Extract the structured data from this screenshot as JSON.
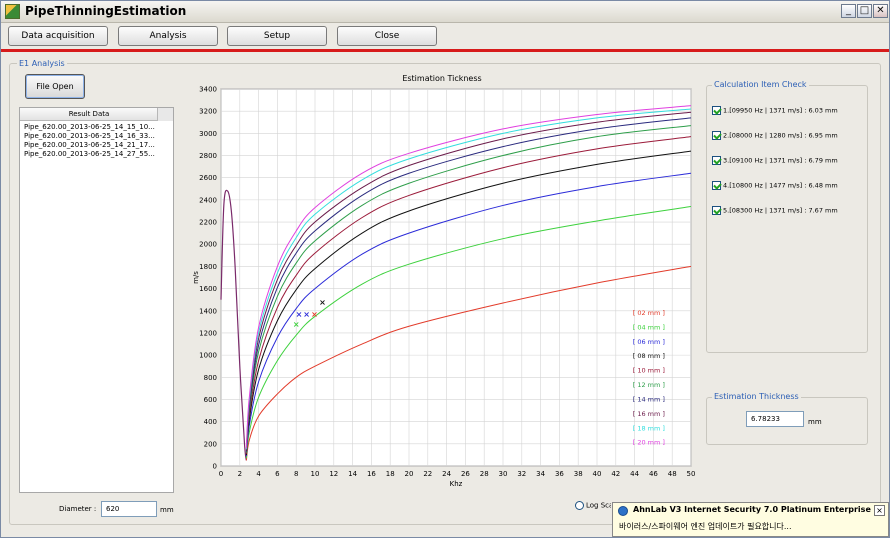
{
  "window": {
    "title": "PipeThinningEstimation",
    "controls": {
      "minimize": "_",
      "maximize": "□",
      "close": "✕"
    }
  },
  "toolbar": {
    "data_acquisition": "Data acquisition",
    "analysis": "Analysis",
    "setup": "Setup",
    "close": "Close"
  },
  "colors": {
    "accent_line": "#d71b1b",
    "group_label": "#2c5fb5"
  },
  "main_group": {
    "label": "E1 Analysis"
  },
  "file_open": "File Open",
  "result": {
    "header": "Result Data",
    "items": [
      "Pipe_620.00_2013-06-25_14_15_10...",
      "Pipe_620.00_2013-06-25_14_16_33...",
      "Pipe_620.00_2013-06-25_14_21_17...",
      "Pipe_620.00_2013-06-25_14_27_55..."
    ]
  },
  "diameter": {
    "label": "Diameter :",
    "value": "620",
    "unit": "mm"
  },
  "log_scale": {
    "label": "Log Scale"
  },
  "calc": {
    "label": "Calculation Item Check",
    "items": [
      "1.[09950 Hz | 1371 m/s] : 6.03 mm",
      "2.[08000 Hz | 1280 m/s] : 6.95 mm",
      "3.[09100 Hz | 1371 m/s] : 6.79 mm",
      "4.[10800 Hz | 1477 m/s] : 6.48 mm",
      "5.[08300 Hz | 1371 m/s] : 7.67 mm"
    ]
  },
  "estimation": {
    "label": "Estimation Thickness",
    "value": "6.78233",
    "unit": "mm"
  },
  "toast": {
    "title": "AhnLab V3 Internet Security 7.0 Platinum Enterprise",
    "message": "바이러스/스파이웨어 엔진 업데이트가 필요합니다..."
  },
  "chart_data": {
    "type": "line",
    "title": "Estimation Tickness",
    "xlabel": "Khz",
    "ylabel": "m/s",
    "xlim": [
      0,
      50
    ],
    "ylim": [
      0,
      3400
    ],
    "xticks": [
      0,
      2,
      4,
      6,
      8,
      10,
      12,
      14,
      16,
      18,
      20,
      22,
      24,
      26,
      28,
      30,
      32,
      34,
      36,
      38,
      40,
      42,
      44,
      46,
      48,
      50
    ],
    "yticks": [
      0,
      200,
      400,
      600,
      800,
      1000,
      1200,
      1400,
      1600,
      1800,
      2000,
      2200,
      2400,
      2600,
      2800,
      3000,
      3200,
      3400
    ],
    "grid": true,
    "legend_position": "bottom-right",
    "series": [
      {
        "name": "[ 02 mm ]",
        "color": "#e23b2a",
        "x": [
          2.7,
          3,
          4,
          6,
          8,
          10,
          15,
          20,
          30,
          40,
          50
        ],
        "y": [
          50,
          230,
          450,
          650,
          800,
          900,
          1100,
          1260,
          1470,
          1650,
          1800
        ]
      },
      {
        "name": "[ 04 mm ]",
        "color": "#3dd13d",
        "x": [
          2.7,
          3,
          4,
          6,
          8,
          10,
          15,
          20,
          30,
          40,
          50
        ],
        "y": [
          70,
          300,
          620,
          950,
          1180,
          1350,
          1640,
          1820,
          2050,
          2210,
          2340
        ]
      },
      {
        "name": "[ 06 mm ]",
        "color": "#2b2bd8",
        "x": [
          2.7,
          3,
          4,
          6,
          8,
          10,
          15,
          20,
          30,
          40,
          50
        ],
        "y": [
          90,
          360,
          760,
          1160,
          1420,
          1600,
          1910,
          2100,
          2350,
          2520,
          2640
        ]
      },
      {
        "name": "[ 08 mm ]",
        "color": "#111111",
        "x": [
          2.7,
          3,
          4,
          6,
          8,
          10,
          15,
          20,
          30,
          40,
          50
        ],
        "y": [
          100,
          410,
          870,
          1310,
          1590,
          1780,
          2100,
          2300,
          2550,
          2720,
          2840
        ]
      },
      {
        "name": "[ 10 mm ]",
        "color": "#9b1b3a",
        "x": [
          2.7,
          3,
          4,
          6,
          8,
          10,
          15,
          20,
          30,
          40,
          50
        ],
        "y": [
          110,
          450,
          950,
          1430,
          1720,
          1920,
          2240,
          2440,
          2690,
          2860,
          2970
        ]
      },
      {
        "name": "[ 12 mm ]",
        "color": "#2e9e4a",
        "x": [
          2.7,
          3,
          4,
          6,
          8,
          10,
          15,
          20,
          30,
          40,
          50
        ],
        "y": [
          120,
          490,
          1030,
          1530,
          1830,
          2030,
          2350,
          2550,
          2800,
          2970,
          3070
        ]
      },
      {
        "name": "[ 14 mm ]",
        "color": "#2a2a7e",
        "x": [
          2.7,
          3,
          4,
          6,
          8,
          10,
          15,
          20,
          30,
          40,
          50
        ],
        "y": [
          130,
          520,
          1090,
          1610,
          1920,
          2120,
          2440,
          2640,
          2880,
          3040,
          3140
        ]
      },
      {
        "name": "[ 16 mm ]",
        "color": "#6b1b4a",
        "x": [
          2.7,
          3,
          4,
          6,
          8,
          10,
          15,
          20,
          30,
          40,
          50
        ],
        "y": [
          140,
          550,
          1150,
          1680,
          1990,
          2200,
          2510,
          2710,
          2950,
          3100,
          3190
        ]
      },
      {
        "name": "[ 18 mm ]",
        "color": "#33dede",
        "x": [
          2.7,
          3,
          4,
          6,
          8,
          10,
          15,
          20,
          30,
          40,
          50
        ],
        "y": [
          150,
          580,
          1200,
          1740,
          2060,
          2270,
          2580,
          2770,
          3000,
          3140,
          3220
        ]
      },
      {
        "name": "[ 20 mm ]",
        "color": "#e040e0",
        "x": [
          2.7,
          3,
          4,
          6,
          8,
          10,
          15,
          20,
          30,
          40,
          50
        ],
        "y": [
          160,
          610,
          1250,
          1800,
          2120,
          2330,
          2640,
          2820,
          3040,
          3170,
          3250
        ]
      }
    ],
    "low_freq_lobe": {
      "x": [
        0,
        0.3,
        0.7,
        1.1,
        1.5,
        2,
        2.5,
        2.7
      ],
      "y": [
        1500,
        2350,
        2480,
        2300,
        1800,
        900,
        200,
        50
      ]
    },
    "points": [
      {
        "x": 8.3,
        "y": 1371,
        "color": "#2b2bd8"
      },
      {
        "x": 9.1,
        "y": 1371,
        "color": "#2b2bd8"
      },
      {
        "x": 9.95,
        "y": 1371,
        "color": "#e23b2a"
      },
      {
        "x": 10.8,
        "y": 1477,
        "color": "#111111"
      },
      {
        "x": 8.0,
        "y": 1280,
        "color": "#3dd13d"
      }
    ]
  }
}
